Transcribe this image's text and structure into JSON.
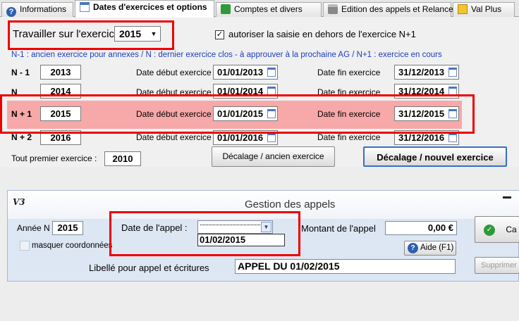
{
  "tabs": [
    {
      "icon": "info-icon",
      "label": "Informations"
    },
    {
      "icon": "calendar-icon",
      "label": "Dates d'exercices et options"
    },
    {
      "icon": "accounts-icon",
      "label": "Comptes et divers"
    },
    {
      "icon": "printer-icon",
      "label": "Edition des appels et Relance"
    },
    {
      "icon": "valplus-icon",
      "label": "Val Plus"
    }
  ],
  "exercise": {
    "label": "Travailler sur l'exercice",
    "value": "2015",
    "checkbox_label": "autoriser la saisie en dehors de l'exercice N+1",
    "checkbox_checked": "✓"
  },
  "info_line": "N-1 : ancien exercice pour annexes  /  N : dernier exercice clos - à approuver à la prochaine AG  /  N+1 : exercice en cours",
  "rows": [
    {
      "label": "N - 1",
      "year": "2013",
      "start_label": "Date début exercice",
      "start": "01/01/2013",
      "end_label": "Date fin exercice",
      "end": "31/12/2013"
    },
    {
      "label": "N",
      "year": "2014",
      "start_label": "Date début exercice",
      "start": "01/01/2014",
      "end_label": "Date fin exercice",
      "end": "31/12/2014"
    },
    {
      "label": "N + 1",
      "year": "2015",
      "start_label": "Date début exercice",
      "start": "01/01/2015",
      "end_label": "Date fin exercice",
      "end": "31/12/2015"
    },
    {
      "label": "N + 2",
      "year": "2016",
      "start_label": "Date début exercice",
      "start": "01/01/2016",
      "end_label": "Date fin exercice",
      "end": "31/12/2016"
    }
  ],
  "first_exercise": {
    "label": "Tout premier exercice :",
    "value": "2010"
  },
  "buttons": {
    "old_shift": "Décalage / ancien exercice",
    "new_shift": "Décalage / nouvel exercice"
  },
  "dialog": {
    "logo": "V3",
    "title": "Gestion des appels",
    "year_label": "Année N",
    "year_value": "2015",
    "hide_coords_label": "masquer coordonnées",
    "call_date_label": "Date de l'appel :",
    "call_date_option": "01/02/2015",
    "amount_label": "Montant de l'appel",
    "amount_value": "0,00 €",
    "help_button": "Aide (F1)",
    "ok_button": "Ca",
    "label_field_label": "Libellé pour appel et écritures",
    "label_field_value": "APPEL DU 01/02/2015",
    "delete_button": "Supprimer à"
  }
}
